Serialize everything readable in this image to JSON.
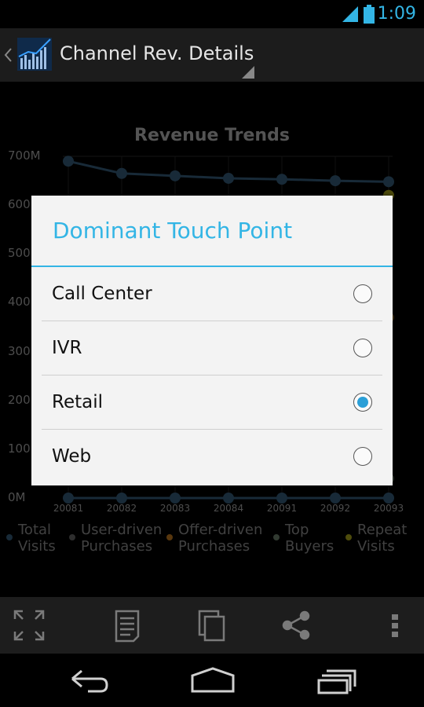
{
  "status": {
    "time": "1:09"
  },
  "app": {
    "title": "Channel Rev. Details"
  },
  "chart_data": {
    "type": "line",
    "title": "Revenue Trends",
    "categories": [
      "20081",
      "20082",
      "20083",
      "20084",
      "20091",
      "20092",
      "20093"
    ],
    "ytick_labels": [
      "700M",
      "600M",
      "500M",
      "400M",
      "300M",
      "200M",
      "100M",
      "0M"
    ],
    "ylim": [
      0,
      700000000
    ],
    "grid": true,
    "legend_position": "bottom",
    "series": [
      {
        "name": "Total Visits",
        "color": "#2c4e66",
        "values": [
          690000000,
          665000000,
          660000000,
          655000000,
          653000000,
          650000000,
          648000000
        ]
      },
      {
        "name": "Repeat Visits",
        "color": "#8f8a16",
        "values": [
          null,
          null,
          null,
          null,
          null,
          null,
          620000000
        ]
      },
      {
        "name": "Offer-driven Purchases",
        "color": "#7a5a20",
        "values": [
          null,
          null,
          null,
          null,
          null,
          null,
          370000000
        ]
      },
      {
        "name": "Top Buyers",
        "color": "#5a6a5a",
        "values": [
          null,
          null,
          null,
          null,
          null,
          null,
          40000000
        ]
      },
      {
        "name": "User-driven Purchases",
        "color": "#2c4e66",
        "values": [
          0,
          0,
          0,
          0,
          0,
          0,
          0
        ]
      }
    ],
    "legend": [
      {
        "line1": "Total",
        "line2": "Visits",
        "color": "#2c4e66"
      },
      {
        "line1": "User-driven",
        "line2": "Purchases",
        "color": "#555555"
      },
      {
        "line1": "Offer-driven",
        "line2": "Purchases",
        "color": "#a0641a"
      },
      {
        "line1": "Top",
        "line2": "Buyers",
        "color": "#5a6a5a"
      },
      {
        "line1": "Repeat",
        "line2": "Visits",
        "color": "#8f8a16"
      }
    ]
  },
  "dialog": {
    "title": "Dominant Touch Point",
    "options": [
      {
        "label": "Call Center",
        "selected": false
      },
      {
        "label": "IVR",
        "selected": false
      },
      {
        "label": "Retail",
        "selected": true
      },
      {
        "label": "Web",
        "selected": false
      }
    ]
  },
  "toolbar": {
    "icons": [
      "fullscreen-icon",
      "document-icon",
      "copy-icon",
      "share-icon",
      "overflow-menu-icon"
    ]
  },
  "navbar": {
    "icons": [
      "back-icon",
      "home-icon",
      "recents-icon"
    ]
  },
  "colors": {
    "accent": "#33b5e5",
    "radio_selected": "#2b9fd7"
  }
}
